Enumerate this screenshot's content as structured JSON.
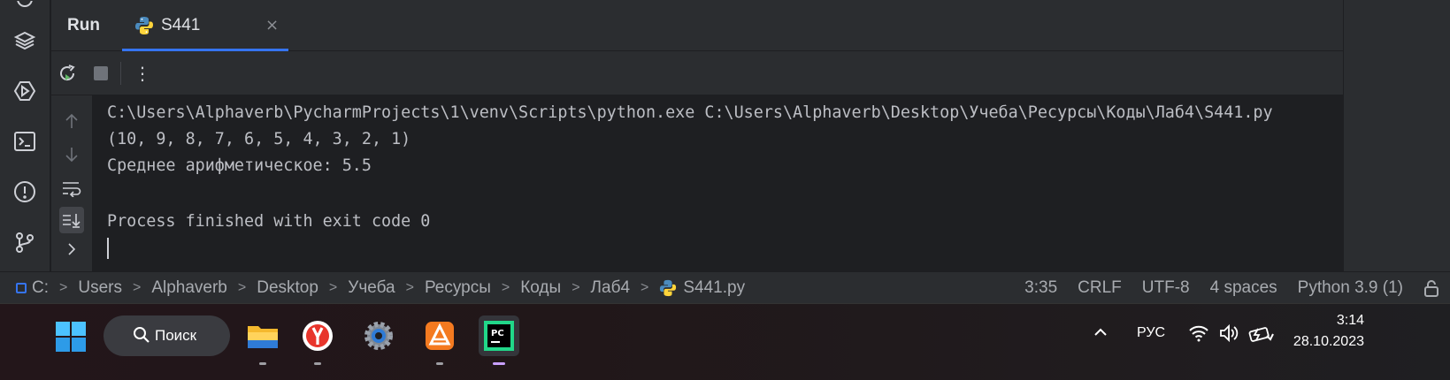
{
  "run_panel": {
    "title": "Run",
    "tab": {
      "label": "S441",
      "close_glyph": "×",
      "icon": "python-file-icon"
    }
  },
  "toolbar": {
    "rerun_icon": "rerun-icon",
    "stop_icon": "stop-icon",
    "more_glyph": "⋮"
  },
  "console": {
    "lines": [
      "C:\\Users\\Alphaverb\\PycharmProjects\\1\\venv\\Scripts\\python.exe C:\\Users\\Alphaverb\\Desktop\\Учеба\\Ресурсы\\Коды\\Лаб4\\S441.py",
      "(10, 9, 8, 7, 6, 5, 4, 3, 2, 1)",
      "Среднее арифметическое: 5.5",
      "",
      "Process finished with exit code 0"
    ]
  },
  "breadcrumb": [
    "C:",
    "Users",
    "Alphaverb",
    "Desktop",
    "Учеба",
    "Ресурсы",
    "Коды",
    "Лаб4",
    "S441.py"
  ],
  "status": {
    "position": "3:35",
    "line_sep": "CRLF",
    "encoding": "UTF-8",
    "indent": "4 spaces",
    "interpreter": "Python 3.9 (1)"
  },
  "taskbar": {
    "search_label": "Поиск",
    "apps": [
      "file-explorer-icon",
      "yandex-browser-icon",
      "settings-icon",
      "aimp-icon",
      "pycharm-icon"
    ],
    "lang": "РУС",
    "time": "3:14",
    "date": "28.10.2023"
  },
  "colors": {
    "accent": "#3574f0",
    "panel_bg": "#2b2d30",
    "editor_bg": "#1e1f22"
  }
}
